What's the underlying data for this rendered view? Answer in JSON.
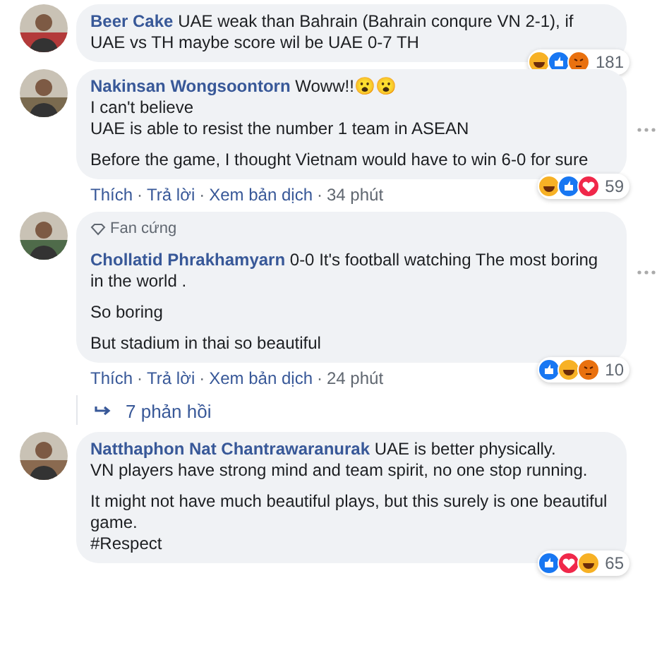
{
  "separator": "·",
  "comments": [
    {
      "author": "Beer Cake",
      "avatar": {
        "kind": "picture"
      },
      "paragraphs": [
        "UAE weak than Bahrain (Bahrain conqure VN 2-1), if UAE vs TH maybe score wil be UAE 0-7 TH"
      ],
      "reactions": [
        {
          "kind": "haha"
        },
        {
          "kind": "like"
        },
        {
          "kind": "angry"
        }
      ],
      "reaction_count": "181",
      "more": false
    },
    {
      "author": "Nakinsan Wongsoontorn",
      "avatar": {
        "kind": "picture"
      },
      "paragraphs": [
        "Woww!!😮😮\nI can't believe\nUAE is able to resist the number 1 team in ASEAN",
        "Before the game, I thought Vietnam would have to win 6-0 for sure"
      ],
      "actions": [
        "Thích",
        "Trả lời",
        "Xem bản dịch",
        "34 phút"
      ],
      "reactions": [
        {
          "kind": "haha"
        },
        {
          "kind": "like"
        },
        {
          "kind": "love"
        }
      ],
      "reaction_count": "59",
      "more": true
    },
    {
      "badge": "Fan cứng",
      "author": "Chollatid Phrakhamyarn",
      "avatar": {
        "kind": "picture"
      },
      "paragraphs": [
        "0-0 It's football watching The most boring in the world .",
        "So boring",
        "But stadium in thai so beautiful"
      ],
      "actions": [
        "Thích",
        "Trả lời",
        "Xem bản dịch",
        "24 phút"
      ],
      "reactions": [
        {
          "kind": "like"
        },
        {
          "kind": "haha"
        },
        {
          "kind": "angry"
        }
      ],
      "reaction_count": "10",
      "replies": "7 phản hồi",
      "more": true
    },
    {
      "author": "Natthaphon Nat Chantrawaranurak",
      "avatar": {
        "kind": "picture"
      },
      "paragraphs": [
        "UAE is better physically.\nVN players have strong mind and team spirit, no one stop running.",
        "It might not have much beautiful plays, but this surely is one beautiful game.\n#Respect"
      ],
      "reactions": [
        {
          "kind": "like"
        },
        {
          "kind": "love"
        },
        {
          "kind": "haha"
        }
      ],
      "reaction_count": "65",
      "more": false
    }
  ]
}
